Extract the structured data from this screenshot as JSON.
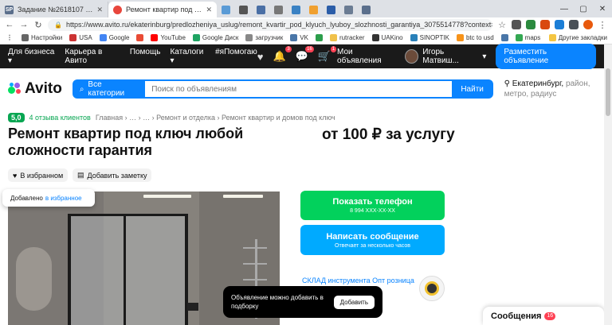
{
  "browser": {
    "tabs": [
      {
        "label": "Задание №2618107 - просмотр з",
        "fav": "SP",
        "color": "#5b6f8c"
      },
      {
        "label": "Ремонт квартир под ключ любой",
        "fav": "",
        "color": "#e8463c",
        "active": true
      },
      {
        "label": "",
        "fav": "",
        "color": "#5a9bd6"
      },
      {
        "label": "",
        "fav": "",
        "color": "#555"
      },
      {
        "label": "",
        "fav": "",
        "color": "#4a6fa5"
      },
      {
        "label": "",
        "fav": "",
        "color": "#777"
      },
      {
        "label": "",
        "fav": "",
        "color": "#3b82c4"
      },
      {
        "label": "",
        "fav": "",
        "color": "#f0a030"
      },
      {
        "label": "",
        "fav": "",
        "color": "#2b5da8"
      },
      {
        "label": "",
        "fav": "",
        "color": "#6b7c93"
      },
      {
        "label": "",
        "fav": "",
        "color": "#5b6f8c"
      }
    ],
    "url": "https://www.avito.ru/ekaterinburg/predlozheniya_uslug/remont_kvartir_pod_klyuch_lyuboy_slozhnosti_garantiya_3075514778?context=...",
    "bookmarks": [
      {
        "label": "Настройки",
        "color": "#666"
      },
      {
        "label": "USA",
        "color": "#c33"
      },
      {
        "label": "Google",
        "color": "#4285f4"
      },
      {
        "label": "",
        "color": "#e94b35"
      },
      {
        "label": "YouTube",
        "color": "#ff0000"
      },
      {
        "label": "Google Диск",
        "color": "#1fa463"
      },
      {
        "label": "загрузчик",
        "color": "#888"
      },
      {
        "label": "VK",
        "color": "#4a76a8"
      },
      {
        "label": "",
        "color": "#2c9e4b"
      },
      {
        "label": "rutracker",
        "color": "#f0c14b"
      },
      {
        "label": "UAKino",
        "color": "#333"
      },
      {
        "label": "SINOPTIK",
        "color": "#2980b9"
      },
      {
        "label": "btc to usd",
        "color": "#f7931a"
      },
      {
        "label": "",
        "color": "#4a76a8"
      },
      {
        "label": "maps",
        "color": "#34a853"
      }
    ],
    "bookmarks_other": "Другие закладки"
  },
  "topbar": {
    "menu": [
      "Для бизнеса",
      "Карьера в Авито",
      "Помощь",
      "Каталоги",
      "#яПомогаю"
    ],
    "badges": {
      "notifications": "3",
      "messages": "16",
      "cart": "1"
    },
    "my_ads": "Мои объявления",
    "user": "Игорь Матвиш...",
    "place_ad": "Разместить объявление"
  },
  "search": {
    "logo": "Avito",
    "categories": "Все категории",
    "placeholder": "Поиск по объявлениям",
    "find": "Найти",
    "city": "Екатеринбург,",
    "city_extra": "район, метро, радиус"
  },
  "crumbs": {
    "rating": "5,0",
    "reviews": "4 отзыва клиентов",
    "path": "Главная  ›  …  ›  …  ›  Ремонт и отделка  ›  Ремонт квартир и домов под ключ"
  },
  "listing": {
    "title": "Ремонт квартир под ключ любой сложности гарантия",
    "price": "от 100 ₽ за услугу",
    "fav_chip": "В избранном",
    "note_chip": "Добавить заметку",
    "fav_toast": "Добавлено",
    "fav_toast_link": "в избранное"
  },
  "contact": {
    "phone_label": "Показать телефон",
    "phone_sub": "8 994 XXX-XX-XX",
    "msg_label": "Написать сообщение",
    "msg_sub": "Отвечает за несколько часов",
    "seller": "СКЛАД инструмента Опт розница"
  },
  "toast": {
    "message": "Объявление можно добавить в подборку",
    "add": "Добавить"
  },
  "messages": {
    "label": "Сообщения",
    "count": "16"
  }
}
